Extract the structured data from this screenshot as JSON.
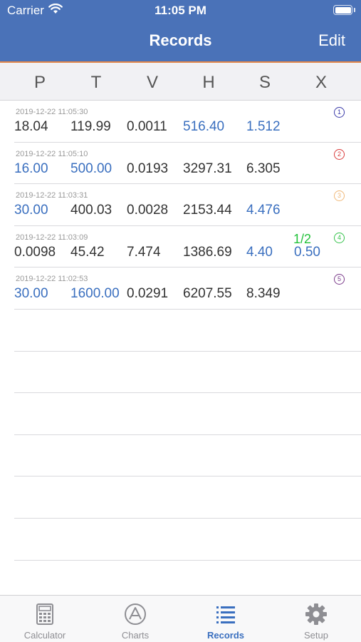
{
  "status": {
    "carrier": "Carrier",
    "time": "11:05 PM"
  },
  "nav": {
    "title": "Records",
    "edit_label": "Edit"
  },
  "columns": [
    "P",
    "T",
    "V",
    "H",
    "S",
    "X"
  ],
  "records": [
    {
      "timestamp": "2019-12-22 11:05:30",
      "p": "18.04",
      "t": "119.99",
      "v": "0.0011",
      "h": "516.40",
      "s": "1.512",
      "x": "",
      "extra": "",
      "badge": "1",
      "badge_color": "#3a3aa8"
    },
    {
      "timestamp": "2019-12-22 11:05:10",
      "p": "16.00",
      "t": "500.00",
      "v": "0.0193",
      "h": "3297.31",
      "s": "6.305",
      "x": "",
      "extra": "",
      "badge": "2",
      "badge_color": "#d93b3b"
    },
    {
      "timestamp": "2019-12-22 11:03:31",
      "p": "30.00",
      "t": "400.03",
      "v": "0.0028",
      "h": "2153.44",
      "s": "4.476",
      "x": "",
      "extra": "",
      "badge": "3",
      "badge_color": "#f0b878"
    },
    {
      "timestamp": "2019-12-22 11:03:09",
      "p": "0.0098",
      "t": "45.42",
      "v": "7.474",
      "h": "1386.69",
      "s": "4.40",
      "x": "0.50",
      "extra": "1/2",
      "badge": "4",
      "badge_color": "#34c24a"
    },
    {
      "timestamp": "2019-12-22 11:02:53",
      "p": "30.00",
      "t": "1600.00",
      "v": "0.0291",
      "h": "6207.55",
      "s": "8.349",
      "x": "",
      "extra": "",
      "badge": "5",
      "badge_color": "#7a3a8a"
    }
  ],
  "tabs": [
    {
      "label": "Calculator",
      "icon": "calculator-icon"
    },
    {
      "label": "Charts",
      "icon": "charts-icon"
    },
    {
      "label": "Records",
      "icon": "list-icon"
    },
    {
      "label": "Setup",
      "icon": "gear-icon"
    }
  ],
  "colors": {
    "header": "#4a72b8",
    "accent": "#3a6fbf",
    "orange_line": "#e2874a",
    "green": "#22c23a"
  }
}
